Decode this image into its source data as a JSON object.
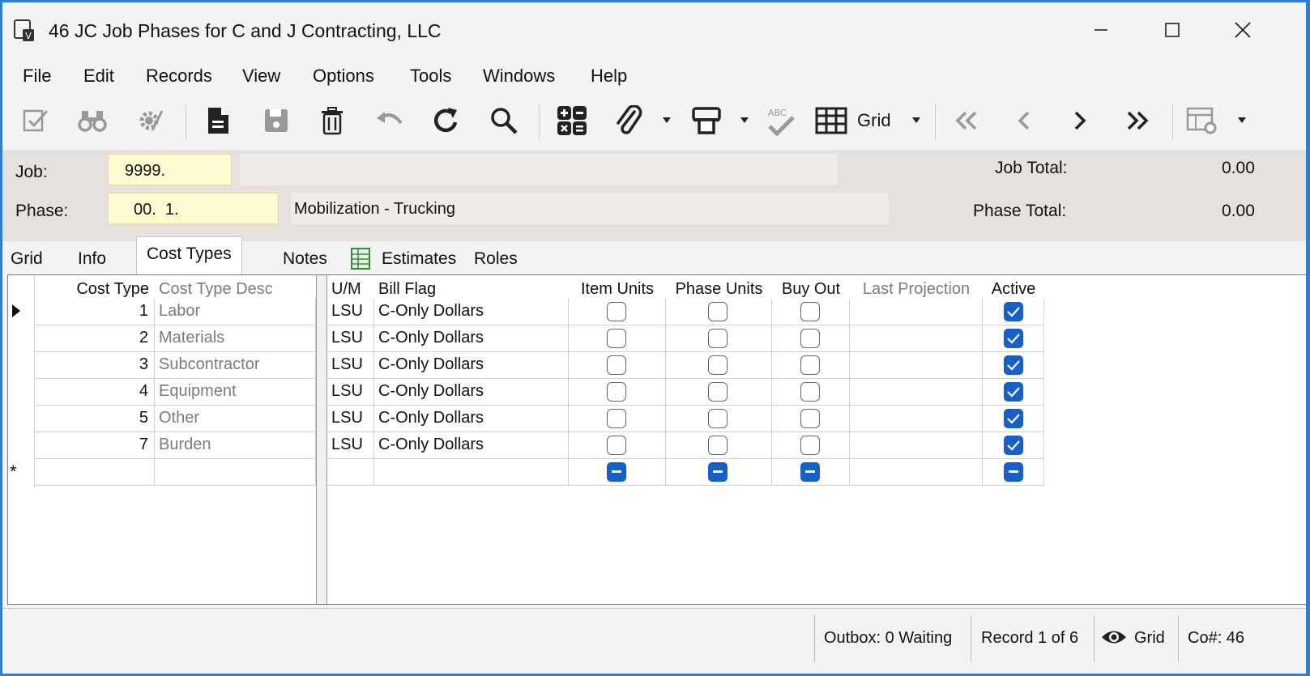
{
  "window": {
    "title": "46 JC Job Phases for C and J Contracting, LLC"
  },
  "menu": [
    "File",
    "Edit",
    "Records",
    "View",
    "Options",
    "Tools",
    "Windows",
    "Help"
  ],
  "toolbar": {
    "view_label": "Grid"
  },
  "header": {
    "job_label": "Job:",
    "job_value": "9999.",
    "job_desc": "",
    "phase_label": "Phase:",
    "phase_value": "00.  1.",
    "phase_desc": "Mobilization - Trucking",
    "job_total_label": "Job Total:",
    "job_total_value": "0.00",
    "phase_total_label": "Phase Total:",
    "phase_total_value": "0.00"
  },
  "tabs": [
    "Grid",
    "Info",
    "Cost Types",
    "Notes",
    "Estimates",
    "Roles"
  ],
  "active_tab": "Cost Types",
  "grid": {
    "columns": [
      "Cost Type",
      "Cost Type Desc",
      "U/M",
      "Bill Flag",
      "Item Units",
      "Phase Units",
      "Buy Out",
      "Last Projection",
      "Active"
    ],
    "rows": [
      {
        "cost_type": "1",
        "desc": "Labor",
        "um": "LSU",
        "bill_flag": "C-Only Dollars",
        "item_units": false,
        "phase_units": false,
        "buy_out": false,
        "last_projection": "",
        "active": true
      },
      {
        "cost_type": "2",
        "desc": "Materials",
        "um": "LSU",
        "bill_flag": "C-Only Dollars",
        "item_units": false,
        "phase_units": false,
        "buy_out": false,
        "last_projection": "",
        "active": true
      },
      {
        "cost_type": "3",
        "desc": "Subcontractor",
        "um": "LSU",
        "bill_flag": "C-Only Dollars",
        "item_units": false,
        "phase_units": false,
        "buy_out": false,
        "last_projection": "",
        "active": true
      },
      {
        "cost_type": "4",
        "desc": "Equipment",
        "um": "LSU",
        "bill_flag": "C-Only Dollars",
        "item_units": false,
        "phase_units": false,
        "buy_out": false,
        "last_projection": "",
        "active": true
      },
      {
        "cost_type": "5",
        "desc": "Other",
        "um": "LSU",
        "bill_flag": "C-Only Dollars",
        "item_units": false,
        "phase_units": false,
        "buy_out": false,
        "last_projection": "",
        "active": true
      },
      {
        "cost_type": "7",
        "desc": "Burden",
        "um": "LSU",
        "bill_flag": "C-Only Dollars",
        "item_units": false,
        "phase_units": false,
        "buy_out": false,
        "last_projection": "",
        "active": true
      }
    ],
    "new_row_marker": "*"
  },
  "status": {
    "outbox": "Outbox: 0 Waiting",
    "record": "Record 1 of 6",
    "view": "Grid",
    "company": "Co#: 46"
  },
  "colors": {
    "accent": "#1660c8",
    "field_yellow": "#fefbd3",
    "header_bg": "#e6e1dc",
    "window_border": "#2f7fcf"
  }
}
